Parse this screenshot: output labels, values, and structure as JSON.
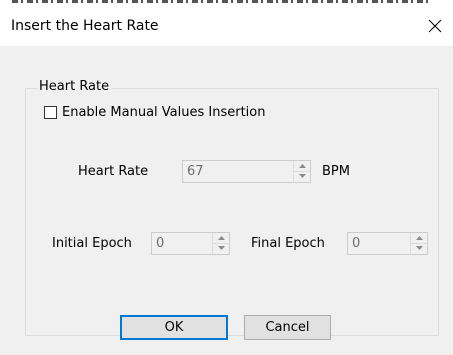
{
  "dialog": {
    "title": "Insert the Heart Rate",
    "close_glyph": "✕"
  },
  "group": {
    "legend": "Heart Rate",
    "manual_checkbox": {
      "label": "Enable Manual Values Insertion",
      "checked": false
    },
    "heart_rate": {
      "label": "Heart Rate",
      "value": "67",
      "unit": "BPM"
    },
    "initial_epoch": {
      "label": "Initial Epoch",
      "value": "0"
    },
    "final_epoch": {
      "label": "Final Epoch",
      "value": "0"
    }
  },
  "buttons": {
    "ok": "OK",
    "cancel": "Cancel"
  },
  "colors": {
    "client_background": "#f0f0f0",
    "disabled_text": "#6d6d6d",
    "default_button_border": "#0078d7"
  }
}
